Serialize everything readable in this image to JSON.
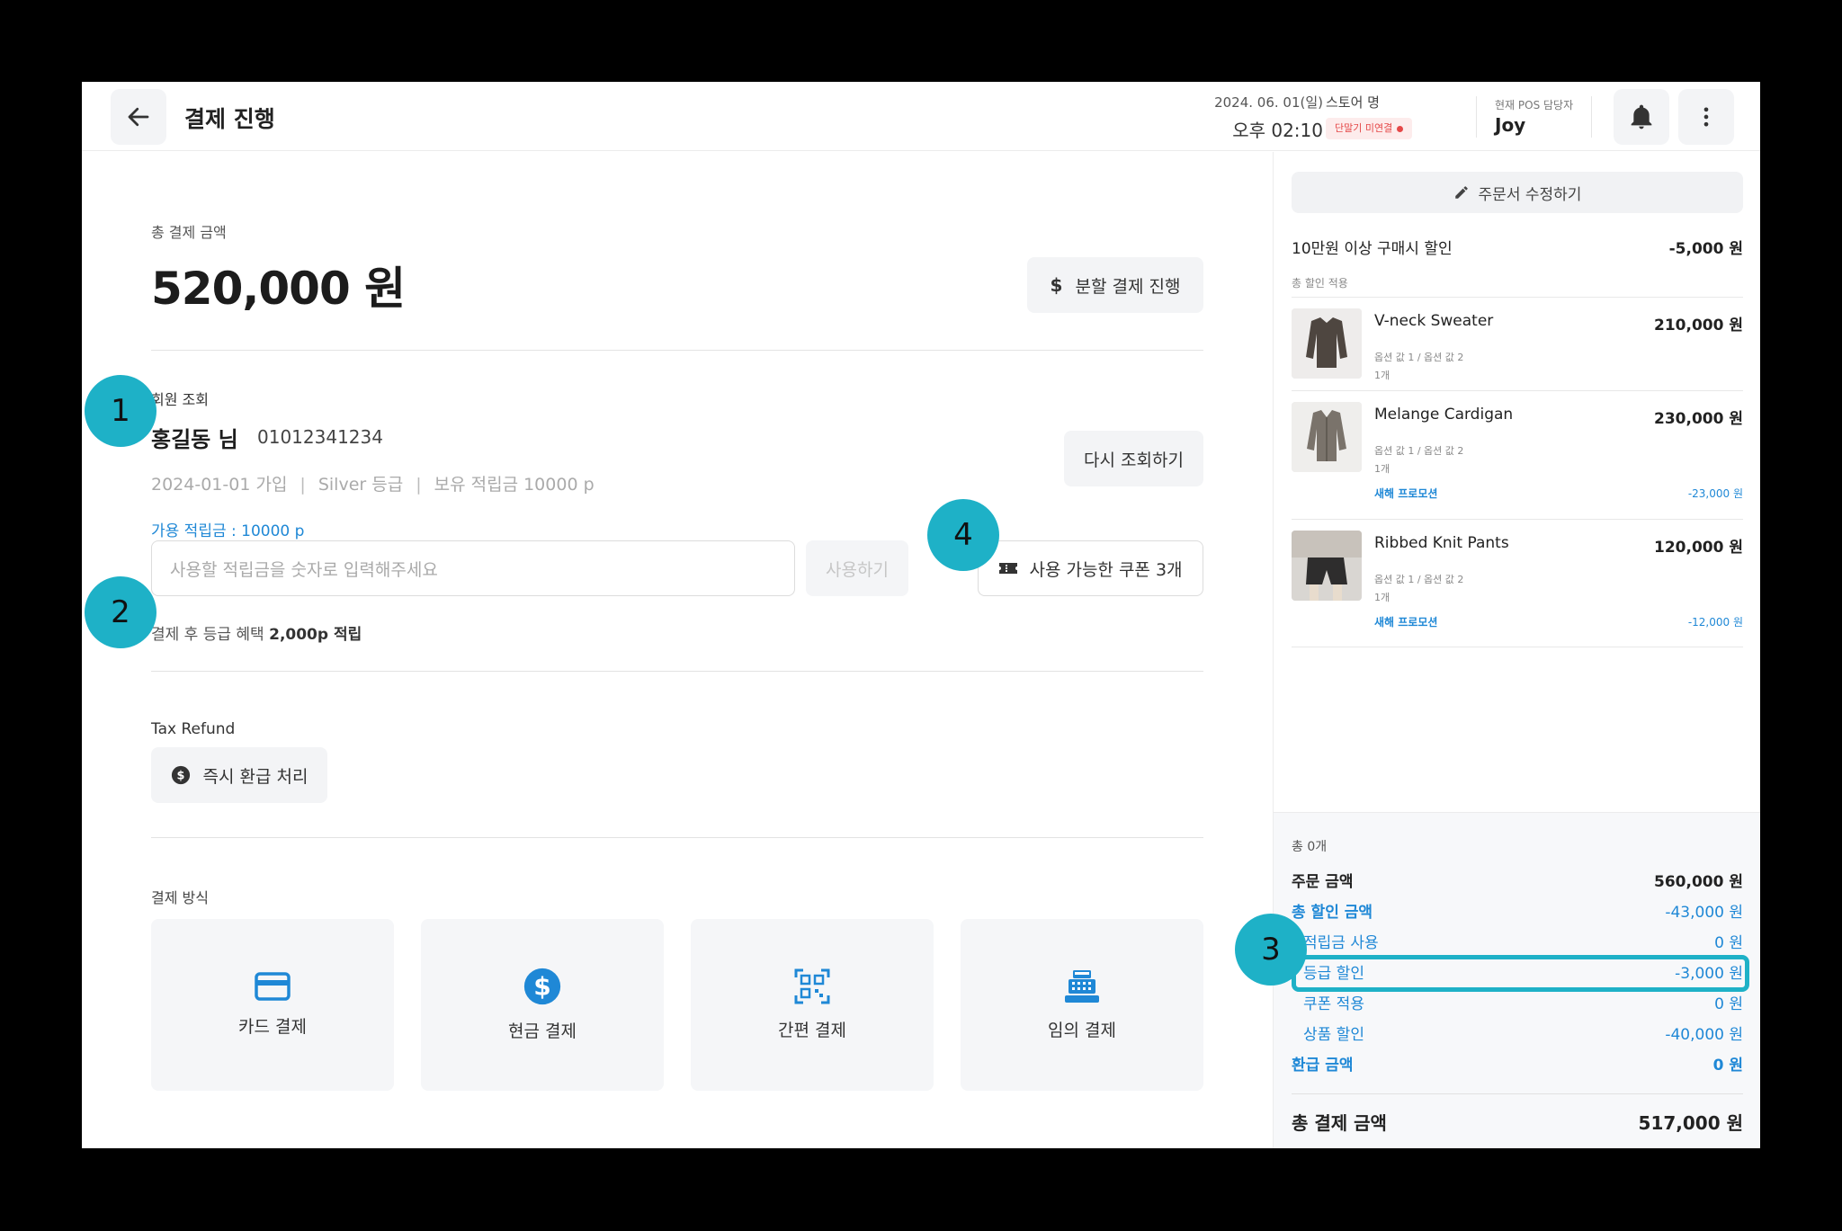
{
  "header": {
    "title": "결제 진행",
    "date": "2024. 06. 01(일)",
    "time": "오후 02:10",
    "store_name": "스토어 명",
    "store_status": "단말기 미연결",
    "staff_label": "현재 POS 담당자",
    "staff_name": "Joy"
  },
  "payment": {
    "total_label": "총 결제 금액",
    "total_amount": "520,000 원",
    "split_label": "분할 결제 진행"
  },
  "member": {
    "section_label": "회원 조회",
    "name": "홍길동 님",
    "phone": "01012341234",
    "join_date": "2024-01-01 가입",
    "grade": "Silver 등급",
    "points_held": "보유 적립금 10000 p",
    "requery_label": "다시 조회하기",
    "available_points": "가용 적립금 : 10000 p",
    "points_placeholder": "사용할 적립금을 숫자로 입력해주세요",
    "use_label": "사용하기",
    "coupon_label": "사용 가능한 쿠폰 3개",
    "grade_benefit_prefix": "결제 후 등급 혜택",
    "grade_benefit_value": "2,000p 적립"
  },
  "tax": {
    "label": "Tax Refund",
    "refund_label": "즉시 환급 처리"
  },
  "methods": {
    "label": "결제 방식",
    "items": [
      {
        "label": "카드 결제",
        "icon": "credit-card-icon"
      },
      {
        "label": "현금 결제",
        "icon": "dollar-circle-icon"
      },
      {
        "label": "간편 결제",
        "icon": "qr-code-icon"
      },
      {
        "label": "임의 결제",
        "icon": "cash-register-icon"
      }
    ]
  },
  "order": {
    "edit_label": "주문서 수정하기",
    "promo_label": "10만원 이상 구매시 할인",
    "promo_amount": "-5,000 원",
    "promo_sub": "총 할인 적용",
    "items": [
      {
        "name": "V-neck Sweater",
        "price": "210,000 원",
        "options": "옵션 값 1 / 옵션 값 2",
        "qty": "1개"
      },
      {
        "name": "Melange Cardigan",
        "price": "230,000 원",
        "options": "옵션 값 1 / 옵션 값 2",
        "qty": "1개",
        "promo_name": "새해 프로모션",
        "promo_amount": "-23,000 원"
      },
      {
        "name": "Ribbed Knit Pants",
        "price": "120,000 원",
        "options": "옵션 값 1 / 옵션 값 2",
        "qty": "1개",
        "promo_name": "새해 프로모션",
        "promo_amount": "-12,000 원"
      }
    ]
  },
  "summary": {
    "count": "총 0개",
    "order_amount_label": "주문 금액",
    "order_amount": "560,000 원",
    "discount_label": "총 할인 금액",
    "discount": "-43,000 원",
    "points_label": "적립금 사용",
    "points": "0 원",
    "grade_label": "등급 할인",
    "grade": "-3,000 원",
    "coupon_label": "쿠폰 적용",
    "coupon": "0 원",
    "product_label": "상품 할인",
    "product": "-40,000 원",
    "refund_label": "환급 금액",
    "refund": "0 원",
    "total_label": "총 결제 금액",
    "total": "517,000 원"
  },
  "markers": [
    "1",
    "2",
    "3",
    "4"
  ],
  "colors": {
    "accent": "#1eb1c7",
    "link_blue": "#1f88d6",
    "alert_red": "#e54848"
  }
}
